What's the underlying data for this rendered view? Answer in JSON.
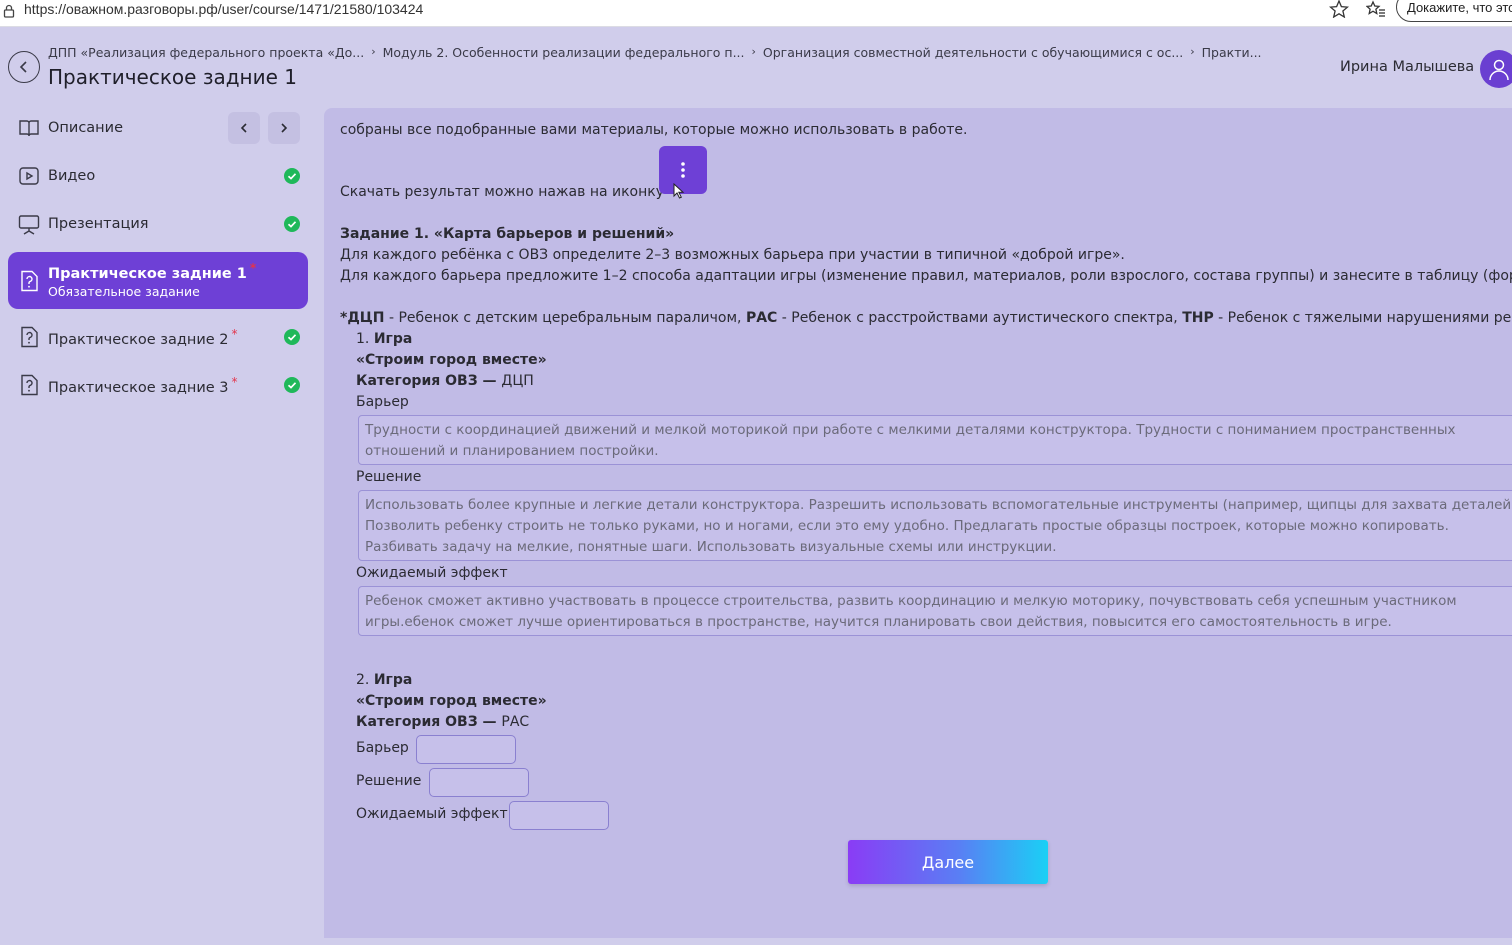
{
  "browser": {
    "url": "https://оважном.разговоры.рф/user/course/1471/21580/103424",
    "captcha": "Докажите, что это вы"
  },
  "header": {
    "breadcrumbs": [
      "ДПП «Реализация федерального проекта «До...",
      "Модуль 2. Особенности реализации федерального п...",
      "Организация совместной деятельности с обучающимися с ос...",
      "Практи..."
    ],
    "title": "Практическое задние 1",
    "user_name": "Ирина Малышева"
  },
  "sidebar": {
    "items": [
      {
        "label": "Описание",
        "icon": "book-icon"
      },
      {
        "label": "Видео",
        "icon": "video-icon",
        "done": true
      },
      {
        "label": "Презентация",
        "icon": "presentation-icon",
        "done": true
      },
      {
        "label": "Практическое задние 1",
        "sub": "Обязательное задание",
        "icon": "question-icon",
        "required": "*"
      },
      {
        "label": "Практическое задние 2",
        "icon": "question-icon",
        "required": "*",
        "done": true
      },
      {
        "label": "Практическое задние 3",
        "icon": "question-icon",
        "required": "*",
        "done": true
      }
    ]
  },
  "content": {
    "intro": "собраны все подобранные вами материалы, которые можно использовать в работе.",
    "download": "Скачать результат можно нажав на иконку",
    "task_title": "Задание 1. «Карта барьеров и решений»",
    "task_line1": "Для каждого ребёнка с ОВЗ определите 2–3 возможных барьера при участии в типичной «доброй игре».",
    "task_line2": "Для каждого барьера предложите 1–2 способа адаптации игры (изменение правил, материалов, роли взрослого, состава группы) и занесите в таблицу (форму).",
    "legend": {
      "dcp_abbr": "*ДЦП",
      "dcp_text": " - Ребенок с детским церебральным параличом, ",
      "ras_abbr": "РАС",
      "ras_text": " - Ребенок с расстройствами аутистического спектра, ",
      "tnr_abbr": "ТНР",
      "tnr_text": " - Ребенок с тяжелыми нарушениями речи"
    },
    "game1": {
      "num": "1. ",
      "game_label": "Игра",
      "game_name": "«Строим город вместе»",
      "category_label": "Категория ОВЗ — ",
      "category_value": "ДЦП",
      "barrier_label": "Барьер",
      "barrier_text": "Трудности с координацией движений и мелкой моторикой при работе с мелкими деталями конструктора. Трудности с пониманием пространственных отношений и планированием постройки.",
      "solution_label": "Решение",
      "solution_text": "Использовать более крупные и легкие детали конструктора. Разрешить использовать вспомогательные инструменты (например, щипцы для захвата деталей). Позволить ребенку строить не только руками, но и ногами, если это ему удобно. Предлагать простые образцы построек, которые можно копировать. Разбивать задачу на мелкие, понятные шаги. Использовать визуальные схемы или инструкции.",
      "effect_label": "Ожидаемый эффект",
      "effect_text": "Ребенок сможет активно участвовать в процессе строительства, развить координацию и мелкую моторику, почувствовать себя успешным участником игры.ебенок сможет лучше ориентироваться в пространстве, научится планировать свои действия, повысится его самостоятельность в игре."
    },
    "game2": {
      "num": "2. ",
      "game_label": "Игра",
      "game_name": "«Строим город вместе»",
      "category_label": "Категория ОВЗ — ",
      "category_value": "РАС",
      "barrier_label": "Барьер",
      "solution_label": "Решение",
      "effect_label": "Ожидаемый эффект"
    },
    "next_label": "Далее"
  },
  "colors": {
    "accent": "#6e40d6",
    "done": "#1fb85a",
    "page_bg": "#d0cdeb",
    "content_bg": "#c1bbe6"
  }
}
